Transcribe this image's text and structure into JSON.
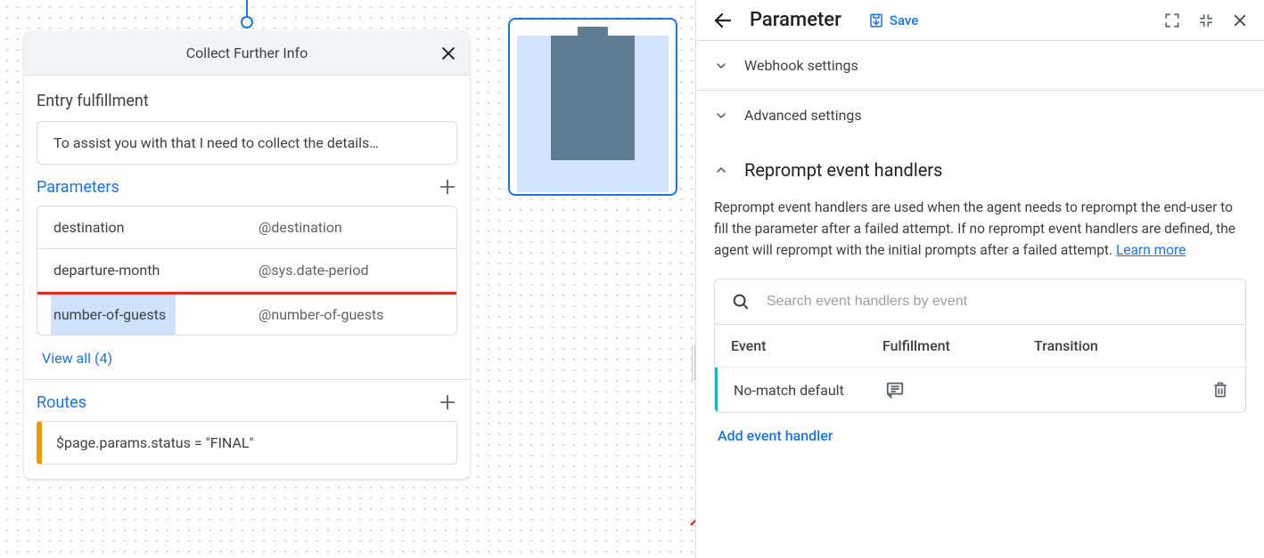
{
  "page_card": {
    "title": "Collect Further Info",
    "entry_fulfillment_label": "Entry fulfillment",
    "entry_fulfillment_text": "To assist you with that I need to collect the details…",
    "parameters_label": "Parameters",
    "parameters": [
      {
        "name": "destination",
        "entity": "@destination"
      },
      {
        "name": "departure-month",
        "entity": "@sys.date-period"
      },
      {
        "name": "number-of-guests",
        "entity": "@number-of-guests"
      }
    ],
    "view_all_label": "View all (4)",
    "routes_label": "Routes",
    "route_condition": "$page.params.status = \"FINAL\""
  },
  "panel": {
    "title": "Parameter",
    "save_label": "Save",
    "collapsed": {
      "webhook": "Webhook settings",
      "advanced": "Advanced settings"
    },
    "reprompt": {
      "heading": "Reprompt event handlers",
      "description": "Reprompt event handlers are used when the agent needs to reprompt the end-user to fill the parameter after a failed attempt. If no reprompt event handlers are defined, the agent will reprompt with the initial prompts after a failed attempt. ",
      "learn_more": "Learn more",
      "search_placeholder": "Search event handlers by event",
      "columns": {
        "event": "Event",
        "fulfillment": "Fulfillment",
        "transition": "Transition"
      },
      "rows": [
        {
          "event": "No-match default"
        }
      ],
      "add_label": "Add event handler"
    }
  }
}
